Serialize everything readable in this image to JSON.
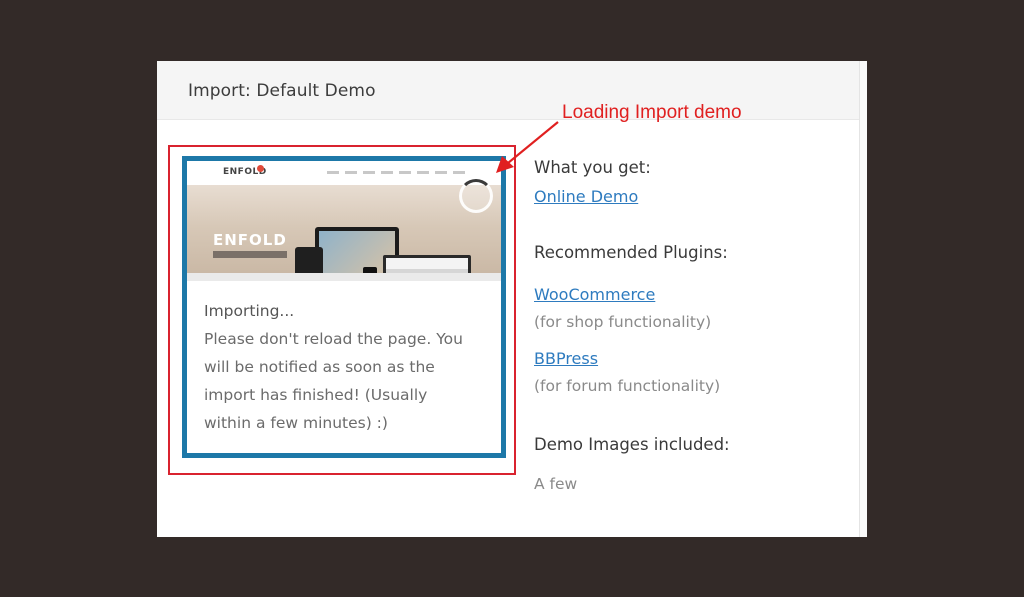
{
  "panel": {
    "title": "Import: Default Demo"
  },
  "annotation": {
    "label": "Loading Import demo",
    "color": "#e02020"
  },
  "demo_card": {
    "border_color": "#1d78a8",
    "preview": {
      "logo": "ENFOLD",
      "hero_logo": "ENFOLD"
    },
    "status_title": "Importing...",
    "status_lines": [
      "Please don't reload the page. You",
      "will be notified as soon as the",
      "import has finished! (Usually",
      "within a few minutes) :)"
    ]
  },
  "info": {
    "what_you_get_heading": "What you get:",
    "online_demo_link": "Online Demo",
    "recommended_heading": "Recommended Plugins:",
    "plugins": [
      {
        "name": "WooCommerce",
        "note": "(for shop functionality)"
      },
      {
        "name": "BBPress",
        "note": "(for forum functionality)"
      }
    ],
    "images_heading": "Demo Images included:",
    "images_value": "A few"
  },
  "colors": {
    "background": "#332a28",
    "link": "#2e7bbf",
    "annotation_red": "#d9232f"
  }
}
